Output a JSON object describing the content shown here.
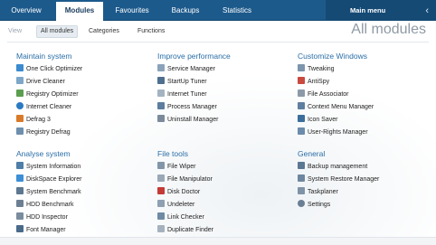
{
  "tabs": [
    {
      "label": "Overview"
    },
    {
      "label": "Modules"
    },
    {
      "label": "Favourites"
    },
    {
      "label": "Backups"
    },
    {
      "label": "Statistics"
    }
  ],
  "main_menu": {
    "label": "Main menu",
    "icon": "chevron-left-icon"
  },
  "subnav": {
    "view_label": "View",
    "all_modules": "All modules",
    "categories": "Categories",
    "functions": "Functions"
  },
  "page_title": "All modules",
  "sections": {
    "maintain": {
      "title": "Maintain system",
      "items": [
        "One Click Optimizer",
        "Drive Cleaner",
        "Registry Optimizer",
        "Internet Cleaner",
        "Defrag 3",
        "Registry Defrag"
      ]
    },
    "improve": {
      "title": "Improve performance",
      "items": [
        "Service Manager",
        "StartUp Tuner",
        "Internet Tuner",
        "Process Manager",
        "Uninstall Manager"
      ]
    },
    "customize": {
      "title": "Customize Windows",
      "items": [
        "Tweaking",
        "AntiSpy",
        "File Associator",
        "Context Menu Manager",
        "Icon Saver",
        "User-Rights Manager"
      ]
    },
    "analyse": {
      "title": "Analyse system",
      "items": [
        "System Information",
        "DiskSpace Explorer",
        "System Benchmark",
        "HDD Benchmark",
        "HDD Inspector",
        "Font Manager"
      ]
    },
    "filetools": {
      "title": "File tools",
      "items": [
        "File Wiper",
        "File Manipulator",
        "Disk Doctor",
        "Undeleter",
        "Link Checker",
        "Duplicate Finder"
      ]
    },
    "general": {
      "title": "General",
      "items": [
        "Backup management",
        "System Restore Manager",
        "Taskplaner",
        "Settings"
      ]
    }
  },
  "colors": {
    "tab_bar": "#1d5a8c",
    "section_title": "#2a6ea6",
    "page_title": "#8f9aa4"
  }
}
